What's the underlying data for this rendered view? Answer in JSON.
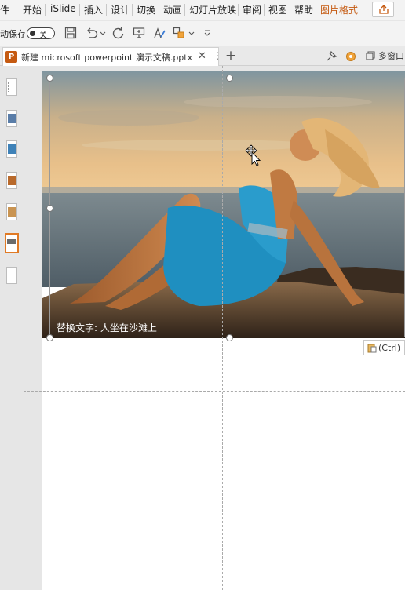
{
  "ribbon": {
    "tabs": [
      {
        "label": "件"
      },
      {
        "label": "开始"
      },
      {
        "label": "iSlide"
      },
      {
        "label": "插入"
      },
      {
        "label": "设计"
      },
      {
        "label": "切换"
      },
      {
        "label": "动画"
      },
      {
        "label": "幻灯片放映"
      },
      {
        "label": "审阅"
      },
      {
        "label": "视图"
      },
      {
        "label": "帮助"
      },
      {
        "label": "图片格式"
      }
    ],
    "active_color": "#c55a11"
  },
  "quick_access": {
    "autosave_label": "动保存",
    "autosave_state": "关"
  },
  "document": {
    "tab_title": "新建 microsoft powerpoint 演示文稿.pptx",
    "app_badge": "P",
    "multi_window_label": "多窗口"
  },
  "slide": {
    "picture_alt_text": "替换文字: 人坐在沙滩上",
    "paste_options_label": "(Ctrl)"
  },
  "colors": {
    "accent": "#e07a25",
    "sea": "#5d6b74",
    "dress": "#1f8fc0"
  },
  "icons": [
    "save-icon",
    "undo-icon",
    "redo-icon",
    "presenter-icon",
    "format-painter-icon",
    "shapes-icon",
    "customize-icon",
    "pin-icon",
    "settings-icon",
    "multi-window-icon",
    "share-icon",
    "paste-icon",
    "move-cursor-icon"
  ]
}
